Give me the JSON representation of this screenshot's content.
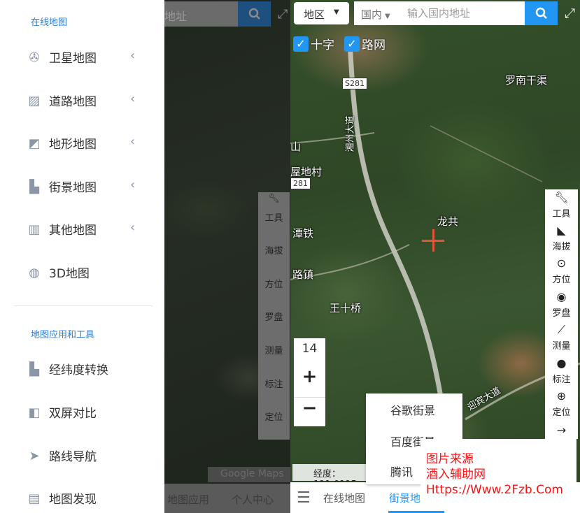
{
  "drawer": {
    "section_online": "在线地图",
    "section_tools": "地图应用和工具",
    "items": [
      {
        "label": "卫星地图",
        "icon": "satellite-icon",
        "chevron": "‹"
      },
      {
        "label": "道路地图",
        "icon": "road-map-icon",
        "chevron": "‹"
      },
      {
        "label": "地形地图",
        "icon": "terrain-icon",
        "chevron": "‹"
      },
      {
        "label": "街景地图",
        "icon": "street-view-icon",
        "chevron": "‹"
      },
      {
        "label": "其他地图",
        "icon": "map-icon",
        "chevron": "‹"
      },
      {
        "label": "3D地图",
        "icon": "globe-icon"
      }
    ],
    "tool_items": [
      {
        "label": "经纬度转换",
        "icon": "coordinate-convert-icon"
      },
      {
        "label": "双屏对比",
        "icon": "split-screen-icon"
      },
      {
        "label": "路线导航",
        "icon": "navigation-icon"
      },
      {
        "label": "地图发现",
        "icon": "discover-icon"
      }
    ]
  },
  "dimmed": {
    "search_text": "地址",
    "google_logo": "Google Maps",
    "tabs": [
      "地图应用",
      "个人中心"
    ]
  },
  "header": {
    "region_label": "地区",
    "scope_label": "国内",
    "search_placeholder": "输入国内地址"
  },
  "layers": {
    "cross_label": "十字",
    "road_label": "路网"
  },
  "map_labels": {
    "luonan": "罗南干渠",
    "longgong": "龙共",
    "wangshiqiao": "王十桥",
    "shan": "山",
    "wudicun": "屋地村",
    "tantie": "潭铁",
    "luzhen": "路镇",
    "yingbin": "迎宾大道",
    "xiangzhou": "湘州大道",
    "s281": "S281",
    "r281": "281"
  },
  "toolbar": [
    {
      "label": "工具",
      "icon": "wrench-icon"
    },
    {
      "label": "海拔",
      "icon": "elevation-icon"
    },
    {
      "label": "方位",
      "icon": "direction-icon"
    },
    {
      "label": "罗盘",
      "icon": "compass-icon"
    },
    {
      "label": "测量",
      "icon": "ruler-icon"
    },
    {
      "label": "标注",
      "icon": "pin-icon"
    },
    {
      "label": "定位",
      "icon": "locate-icon"
    },
    {
      "label": "",
      "icon": "arrow-right-icon"
    }
  ],
  "zoom": {
    "level": "14",
    "in": "+",
    "out": "−"
  },
  "coordinate_text": "经度：111.0115",
  "bottom_tabs": {
    "online": "在线地图",
    "street": "街景地"
  },
  "streetview_popup": [
    "谷歌街景",
    "百度街景",
    "腾讯"
  ],
  "watermark": [
    "图片来源",
    "酒入辅助网",
    "Https://Www.2Fzb.Com"
  ]
}
